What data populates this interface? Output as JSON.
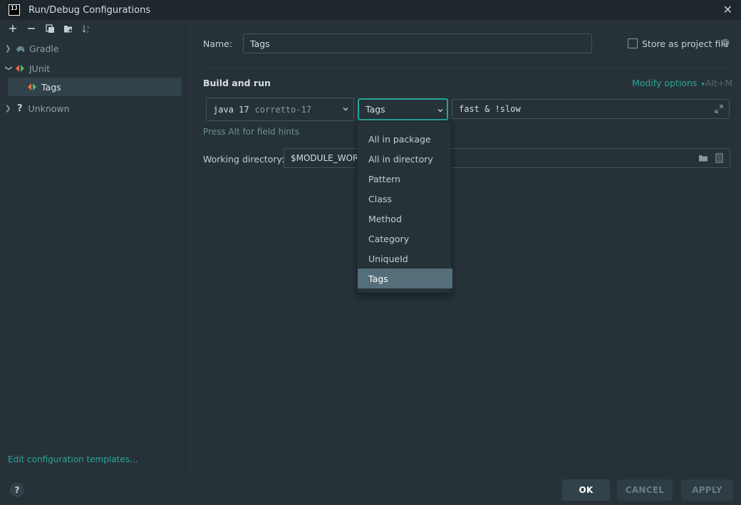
{
  "window": {
    "title": "Run/Debug Configurations",
    "logo_text": "IJ"
  },
  "toolbar": {
    "icons": [
      "add-icon",
      "remove-icon",
      "copy-icon",
      "folder-add-icon",
      "sort-icon"
    ]
  },
  "tree": {
    "items": [
      {
        "label": "Gradle",
        "icon": "gradle-elephant-icon",
        "expanded": false
      },
      {
        "label": "JUnit",
        "icon": "junit-icon",
        "expanded": true
      },
      {
        "label": "Tags",
        "icon": "junit-icon",
        "selected": true
      },
      {
        "label": "Unknown",
        "icon": "question-icon",
        "expanded": false
      }
    ]
  },
  "edit_templates_link": "Edit configuration templates...",
  "form": {
    "name_label": "Name:",
    "name_value": "Tags",
    "store_label": "Store as project file",
    "section_title": "Build and run",
    "modify_options": "Modify options",
    "modify_shortcut": "Alt+M",
    "jre_main": "java 17",
    "jre_sub": "corretto-17",
    "test_kind_value": "Tags",
    "tags_expression": "fast & !slow",
    "field_hint": "Press Alt for field hints",
    "workdir_label": "Working directory:",
    "workdir_value": "$MODULE_WORK"
  },
  "dropdown": {
    "options": [
      "All in package",
      "All in directory",
      "Pattern",
      "Class",
      "Method",
      "Category",
      "UniqueId",
      "Tags"
    ],
    "selected": "Tags"
  },
  "footer": {
    "help": "?",
    "ok": "OK",
    "cancel": "CANCEL",
    "apply": "APPLY"
  },
  "colors": {
    "accent": "#26a69a",
    "background": "#263238",
    "selection": "#546e7a"
  }
}
